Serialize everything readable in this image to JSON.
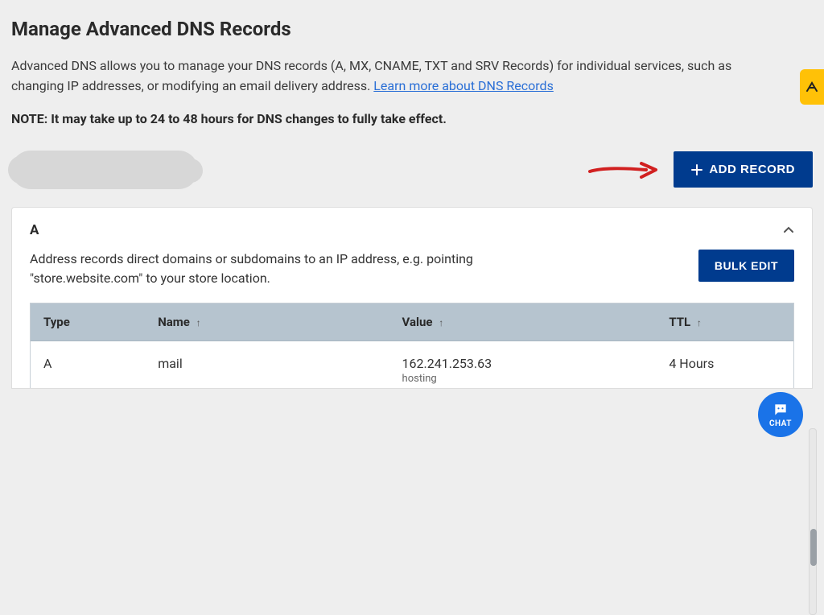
{
  "header": {
    "title": "Manage Advanced DNS Records",
    "intro_prefix": "Advanced DNS allows you to manage your DNS records (A, MX, CNAME, TXT and SRV Records) for individual services, such as changing IP addresses, or modifying an email delivery address. ",
    "intro_link": "Learn more about DNS Records",
    "note": "NOTE: It may take up to 24 to 48 hours for DNS changes to fully take effect."
  },
  "actions": {
    "add_record_label": "ADD RECORD"
  },
  "section_a": {
    "letter": "A",
    "description": "Address records direct domains or subdomains to an IP address, e.g. pointing \"store.website.com\" to your store location.",
    "bulk_edit_label": "BULK EDIT"
  },
  "table": {
    "columns": {
      "type": "Type",
      "name": "Name",
      "value": "Value",
      "ttl": "TTL"
    },
    "rows": [
      {
        "type": "A",
        "name": "mail",
        "value": "162.241.253.63",
        "value_sub": "hosting",
        "ttl": "4 Hours"
      }
    ]
  },
  "chat": {
    "label": "CHAT"
  },
  "colors": {
    "primary": "#003b8e",
    "link": "#2a6fd6",
    "header_row": "#b6c4cf",
    "accent_yellow": "#ffc107",
    "chat_blue": "#1a73e8",
    "annotation_red": "#d12020"
  }
}
